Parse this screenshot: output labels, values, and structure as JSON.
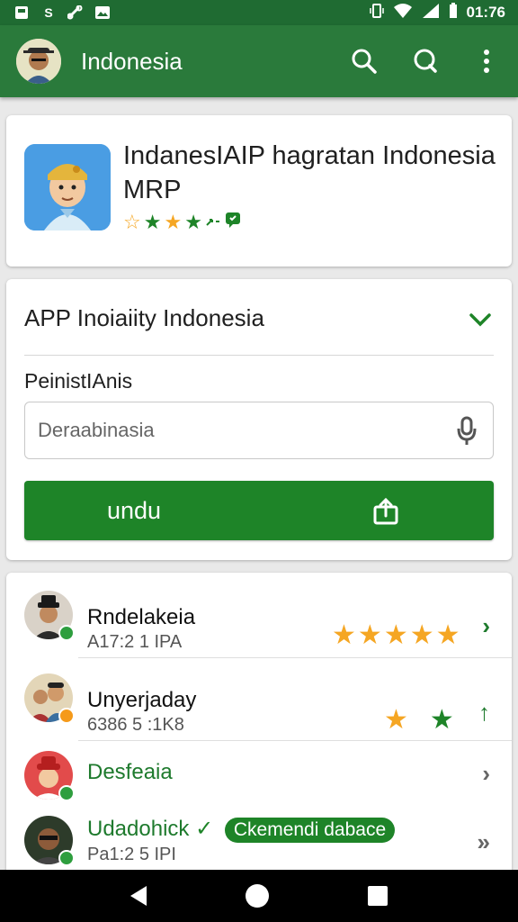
{
  "status_bar": {
    "time": "01:76",
    "left_icons": [
      "notification-icon",
      "s-icon",
      "link-icon",
      "image-icon"
    ]
  },
  "app_bar": {
    "title": "Indonesia",
    "actions": [
      "search-icon",
      "chat-search-icon",
      "more-vert-icon"
    ]
  },
  "app_card": {
    "name": "IndanesIAIP hagratan Indonesia MRP",
    "rating_icons": [
      "☆",
      "★",
      "★",
      "★"
    ]
  },
  "form": {
    "title": "APP Inoiaiity Indonesia",
    "field_label": "PeinistIAnis",
    "input_placeholder": "Deraabinasia",
    "button_label": "undu"
  },
  "list": {
    "items": [
      {
        "name": "Rndelakeia",
        "sub": "A17:2 1 IPA",
        "stars": 5,
        "badge_color": "#2e9e3e",
        "chevron": "›"
      },
      {
        "name": "Unyerjaday",
        "sub": "6386 5 :1K8",
        "stars_mixed": [
          "★",
          "★"
        ],
        "badge_color": "#f59a1a",
        "chevron": "↑"
      },
      {
        "name": "Desfeaia",
        "sub": "",
        "badge_color": "#2e9e3e",
        "chevron": "›"
      },
      {
        "name": "Udadohick",
        "tag": "Ckemendi dabace",
        "sub": "Pa1:2 5 IPI",
        "chevron": "»"
      }
    ]
  },
  "colors": {
    "primary": "#2a7a3b",
    "button": "#1e8428",
    "star_gold": "#f5a623",
    "star_green": "#1e8428"
  }
}
